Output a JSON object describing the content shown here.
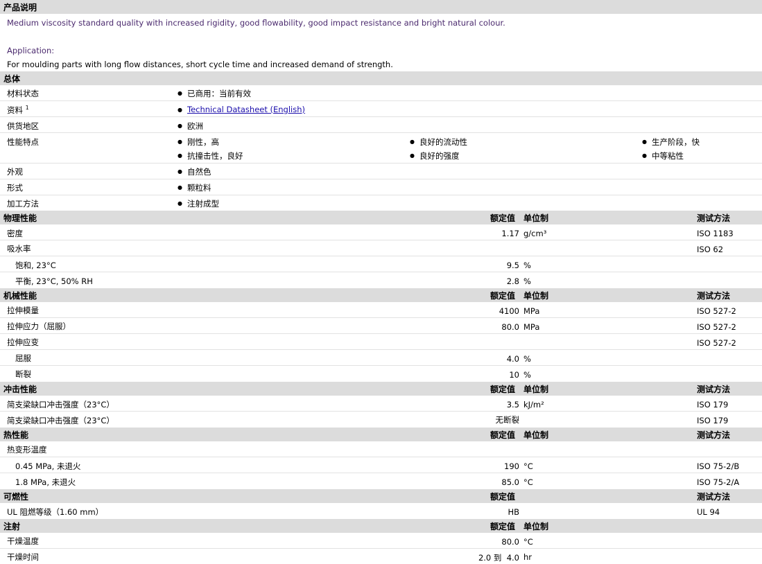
{
  "desc": {
    "title": "产品说明",
    "text": "Medium viscosity standard quality with increased rigidity, good flowability, good impact resistance and bright natural colour.",
    "app_label": "Application:",
    "app_text": "For moulding parts with long flow distances, short cycle time and increased demand of strength."
  },
  "general": {
    "title": "总体",
    "status_label": "材料状态",
    "status_value": "已商用：当前有效",
    "doc_label": "资料",
    "doc_sup": "1",
    "doc_link": "Technical Datasheet (English)",
    "region_label": "供货地区",
    "region_value": "欧洲",
    "features_label": "性能特点",
    "features": [
      "刚性，高",
      "良好的流动性",
      "生产阶段，快",
      "抗撞击性，良好",
      "良好的强度",
      "中等粘性"
    ],
    "appearance_label": "外观",
    "appearance_value": "自然色",
    "form_label": "形式",
    "form_value": "颗粒料",
    "process_label": "加工方法",
    "process_value": "注射成型"
  },
  "col": {
    "nominal": "额定值",
    "unit": "单位制",
    "method": "测试方法"
  },
  "physical": {
    "title": "物理性能",
    "density": {
      "label": "密度",
      "value": "1.17",
      "unit": "g/cm³",
      "method": "ISO 1183"
    },
    "water": {
      "label": "吸水率",
      "method": "ISO 62"
    },
    "sat": {
      "label": "饱和, 23°C",
      "value": "9.5",
      "unit": "%"
    },
    "eq": {
      "label": "平衡, 23°C, 50% RH",
      "value": "2.8",
      "unit": "%"
    }
  },
  "mechanical": {
    "title": "机械性能",
    "modulus": {
      "label": "拉伸模量",
      "value": "4100",
      "unit": "MPa",
      "method": "ISO 527-2"
    },
    "stress": {
      "label": "拉伸应力（屈服）",
      "value": "80.0",
      "unit": "MPa",
      "method": "ISO 527-2"
    },
    "strain": {
      "label": "拉伸应变",
      "method": "ISO 527-2"
    },
    "yield": {
      "label": "屈服",
      "value": "4.0",
      "unit": "%"
    },
    "break": {
      "label": "断裂",
      "value": "10",
      "unit": "%"
    }
  },
  "impact": {
    "title": "冲击性能",
    "notched": {
      "label": "简支梁缺口冲击强度（23°C）",
      "value": "3.5",
      "unit": "kJ/m²",
      "method": "ISO 179"
    },
    "unnotched": {
      "label": "简支梁缺口冲击强度（23°C）",
      "value": "无断裂",
      "method": "ISO 179"
    }
  },
  "thermal": {
    "title": "热性能",
    "hdt": {
      "label": "热变形温度"
    },
    "hdt045": {
      "label": "0.45 MPa, 未退火",
      "value": "190",
      "unit": "°C",
      "method": "ISO 75-2/B"
    },
    "hdt18": {
      "label": "1.8 MPa, 未退火",
      "value": "85.0",
      "unit": "°C",
      "method": "ISO 75-2/A"
    }
  },
  "flame": {
    "title": "可燃性",
    "ul": {
      "label": "UL 阻燃等级（1.60 mm）",
      "value": "HB",
      "method": "UL 94"
    }
  },
  "injection": {
    "title": "注射",
    "drytemp": {
      "label": "干燥温度",
      "value": "80.0",
      "unit": "°C"
    },
    "drytime": {
      "label": "干燥时间",
      "value": "2.0 到  4.0",
      "unit": "hr"
    }
  }
}
